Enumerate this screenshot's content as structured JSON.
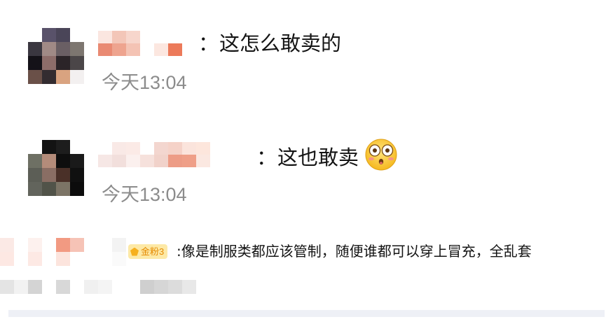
{
  "comments": [
    {
      "separator": "：",
      "text": "这怎么敢卖的",
      "time": "今天13:04"
    },
    {
      "separator": "：",
      "text": "这也敢卖",
      "time": "今天13:04",
      "emoji": "flushed-face-icon"
    },
    {
      "badge": "金粉3",
      "text": ":像是制服类都应该管制，随便谁都可以穿上冒充，全乱套"
    }
  ],
  "colors": {
    "time_gray": "#8c8c8c",
    "badge_bg": "#fde9a6",
    "badge_text": "#e58a00",
    "bottom_bar": "#eef0f6"
  }
}
